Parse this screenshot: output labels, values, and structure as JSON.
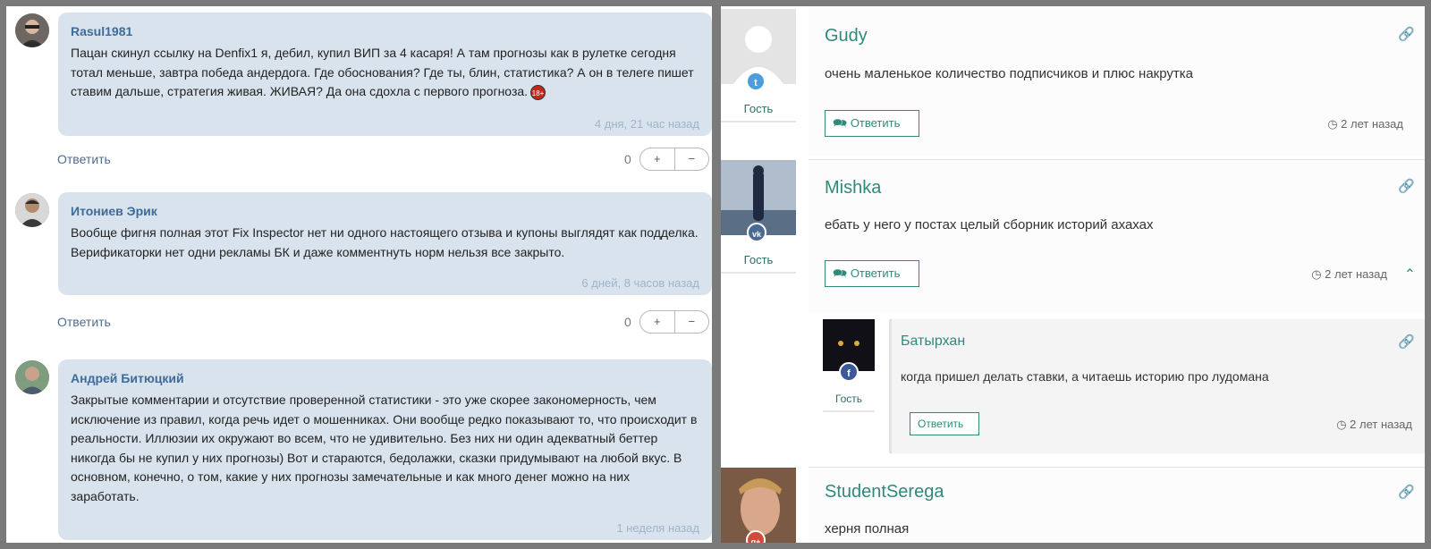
{
  "left_comments": [
    {
      "author": "Rasul1981",
      "text": "Пацан скинул ссылку на Denfix1 я, дебил, купил ВИП за 4 касаря! А там прогнозы как в рулетке сегодня тотал меньше, завтра победа андердога. Где обоснования? Где ты, блин, статистика? А он в телеге пишет ставим дальше, стратегия живая. ЖИВАЯ? Да она сдохла с первого прогноза.",
      "emoji": "18+",
      "time": "4 дня, 21 час назад",
      "reply_label": "Ответить",
      "votes": "0",
      "plus": "+",
      "minus": "−"
    },
    {
      "author": "Итониев Эрик",
      "text": "Вообще фигня полная этот Fix Inspector нет ни одного настоящего отзыва и купоны выглядят как подделка. Верификаторки нет одни рекламы БК и даже комментнуть норм нельзя все закрыто.",
      "time": "6 дней, 8 часов назад",
      "reply_label": "Ответить",
      "votes": "0",
      "plus": "+",
      "minus": "−"
    },
    {
      "author": "Андрей Битюцкий",
      "text": "Закрытые комментарии и отсутствие проверенной статистики - это уже скорее закономерность, чем исключение из правил, когда речь идет о мошенниках. Они вообще редко показывают то, что происходит в реальности. Иллюзии их окружают во всем, что не удивительно. Без них ни один адекватный беттер никогда бы не купил у них прогнозы) Вот и стараются, бедолажки, сказки придумывают на любой вкус. В основном, конечно, о том, какие у них прогнозы замечательные и как много денег можно на них заработать.",
      "time": "1 неделя назад"
    }
  ],
  "right_comments": [
    {
      "author": "Gudy",
      "role": "Гость",
      "social": "twitter-icon",
      "text": "очень маленькое количество подписчиков и плюс накрутка",
      "reply_label": "Ответить",
      "time": "2 лет назад"
    },
    {
      "author": "Mishka",
      "role": "Гость",
      "social": "vk-icon",
      "text": "ебать у него у постах целый сборник историй ахахах",
      "reply_label": "Ответить",
      "time": "2 лет назад"
    },
    {
      "author": "Батырхан",
      "role": "Гость",
      "social": "facebook-icon",
      "text": "когда пришел делать ставки, а читаешь историю про лудомана",
      "reply_label": "Ответить",
      "time": "2 лет назад"
    },
    {
      "author": "StudentSerega",
      "social": "google-plus-icon",
      "text": "херня полная"
    }
  ],
  "icons": {
    "twitter": "t",
    "vk": "vk",
    "facebook": "f",
    "google": "g+"
  },
  "colors": {
    "accent": "#2f8a7a",
    "bubble": "#d9e3ee",
    "username_left": "#3d6b9a"
  }
}
